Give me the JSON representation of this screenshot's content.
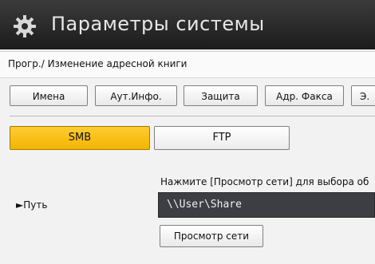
{
  "window": {
    "title": "Параметры системы",
    "icon": "gear-icon"
  },
  "breadcrumb": "Прогр./ Изменение адресной книги",
  "tabs": [
    {
      "label": "Имена"
    },
    {
      "label": "Аут.Инфо."
    },
    {
      "label": "Защита"
    },
    {
      "label": "Адр. Факса"
    },
    {
      "label": "Э."
    }
  ],
  "protocols": {
    "smb": "SMB",
    "ftp": "FTP",
    "selected": "SMB"
  },
  "path": {
    "label": "►Путь",
    "hint": "Нажмите [Просмотр сети] для выбора об",
    "value": "\\\\User\\Share",
    "browse_label": "Просмотр сети"
  },
  "colors": {
    "selected_tab": "#f4b400",
    "title_bar": "#2a2a2a"
  }
}
